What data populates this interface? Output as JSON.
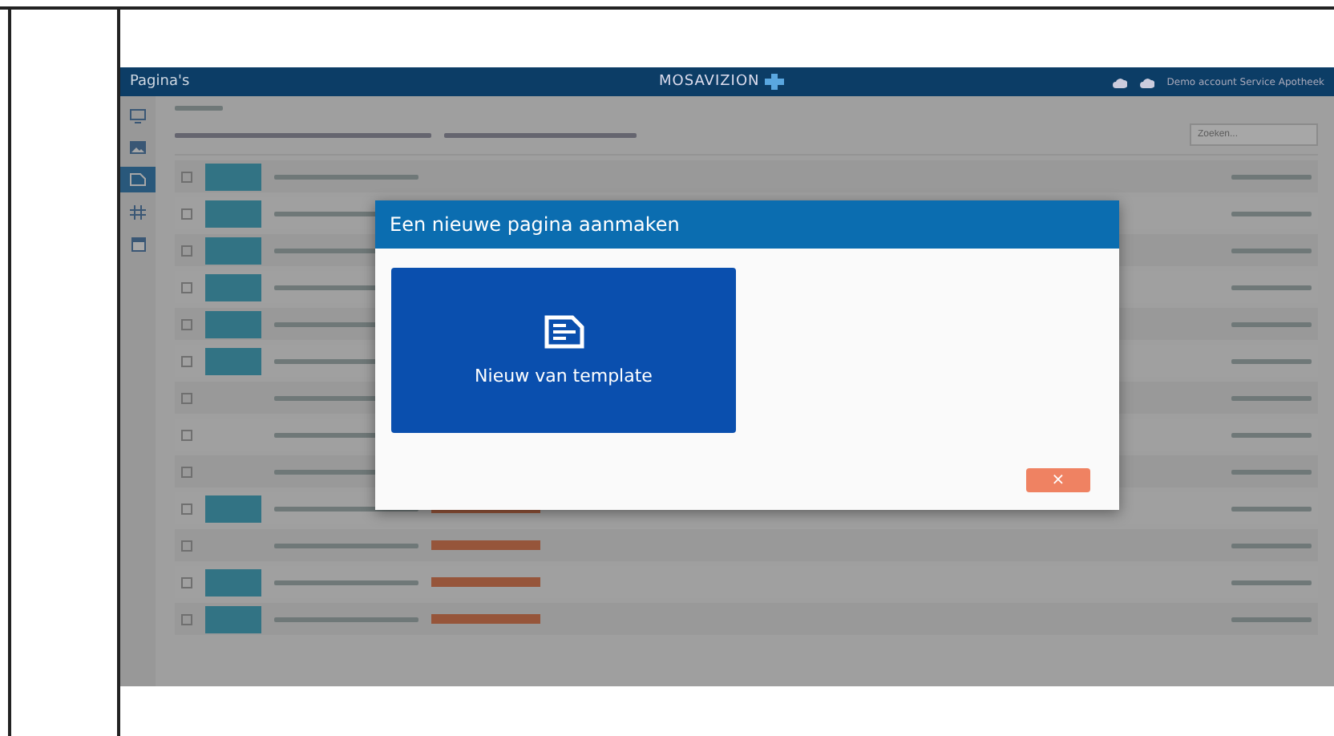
{
  "app": {
    "title": "Pagina's",
    "logo": "MOSAVIZION",
    "account": "Demo account Service Apotheek",
    "search": {
      "placeholder": "Zoeken..."
    }
  },
  "sidebar": {
    "items": [
      {
        "selected": false
      },
      {
        "selected": false
      },
      {
        "selected": true
      },
      {
        "selected": false
      },
      {
        "selected": false
      }
    ]
  },
  "rows": [
    {
      "kind": "photo"
    },
    {
      "kind": "photo"
    },
    {
      "kind": "photo"
    },
    {
      "kind": "photo"
    },
    {
      "kind": "photo"
    },
    {
      "kind": "photo"
    },
    {
      "kind": "blank"
    },
    {
      "kind": "blank"
    },
    {
      "kind": "blank"
    },
    {
      "kind": "photo",
      "tag": true
    },
    {
      "kind": "blank",
      "tag": true
    },
    {
      "kind": "photo",
      "tag": true
    },
    {
      "kind": "photo",
      "tag": true
    }
  ],
  "dialog": {
    "title": "Een nieuwe pagina aanmaken",
    "tile_label": "Nieuw van template",
    "close": "×"
  }
}
